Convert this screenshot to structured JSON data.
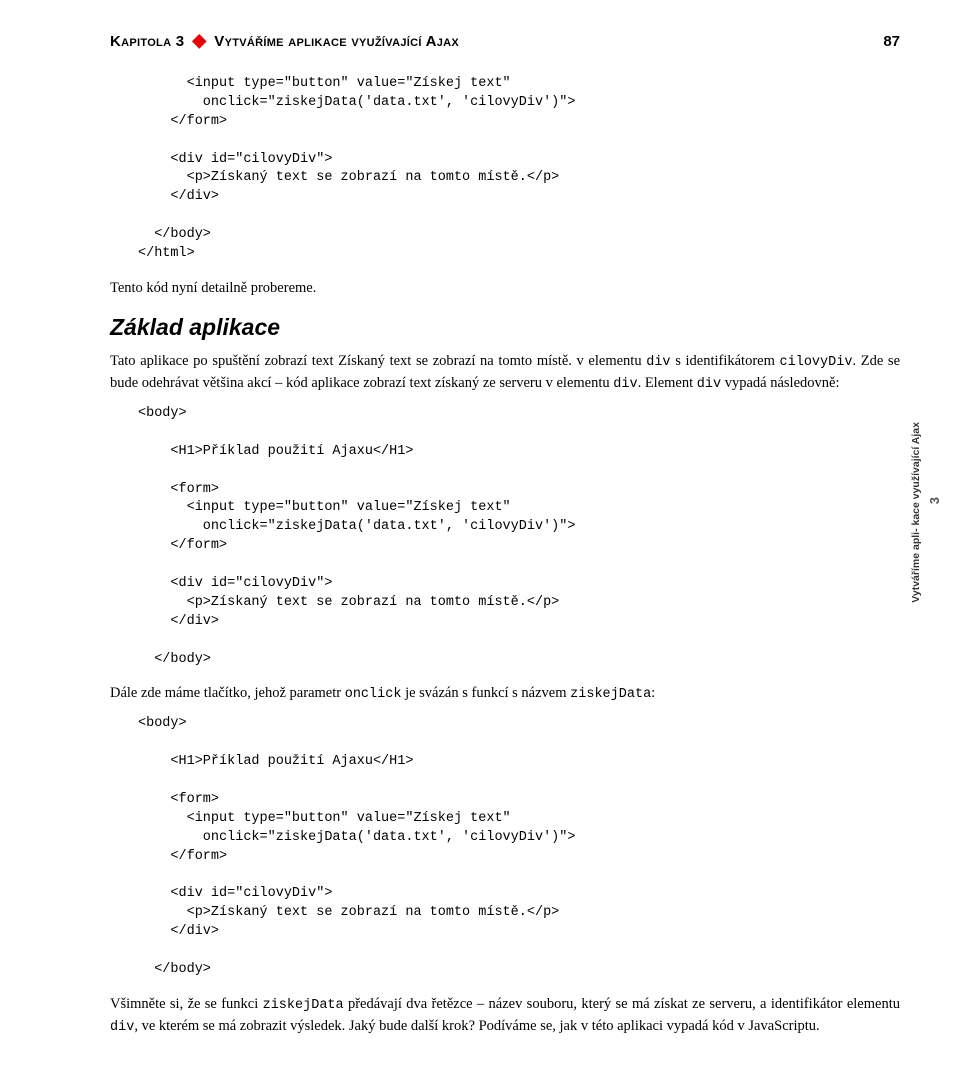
{
  "header": {
    "chapter": "Kapitola 3",
    "title": "Vytváříme aplikace využívající Ajax",
    "pageNum": "87"
  },
  "code1": "      <input type=\"button\" value=\"Získej text\"\n        onclick=\"ziskejData('data.txt', 'cilovyDiv')\">\n    </form>\n\n    <div id=\"cilovyDiv\">\n      <p>Získaný text se zobrazí na tomto místě.</p>\n    </div>\n\n  </body>\n</html>",
  "para1": "Tento kód nyní detailně probereme.",
  "section1": "Základ aplikace",
  "para2a": "Tato aplikace po spuštění zobrazí text Získaný text se zobrazí na tomto místě. v elementu ",
  "para2b": " s identifikátorem ",
  "para2c": ". Zde se bude odehrávat většina akcí – kód aplikace zobrazí text získaný ze serveru v elementu ",
  "para2d": ". Element ",
  "para2e": " vypadá následovně:",
  "mono_div": "div",
  "mono_cilovy": "cilovyDiv",
  "code2": "<body>\n\n    <H1>Příklad použití Ajaxu</H1>\n\n    <form>\n      <input type=\"button\" value=\"Získej text\"\n        onclick=\"ziskejData('data.txt', 'cilovyDiv')\">\n    </form>\n\n    <div id=\"cilovyDiv\">\n      <p>Získaný text se zobrazí na tomto místě.</p>\n    </div>\n\n  </body>",
  "para3a": "Dále zde máme tlačítko, jehož parametr ",
  "para3b": " je svázán s funkcí s názvem ",
  "para3c": ":",
  "mono_onclick": "onclick",
  "mono_ziskej": "ziskejData",
  "code3": "<body>\n\n    <H1>Příklad použití Ajaxu</H1>\n\n    <form>\n      <input type=\"button\" value=\"Získej text\"\n        onclick=\"ziskejData('data.txt', 'cilovyDiv')\">\n    </form>\n\n    <div id=\"cilovyDiv\">\n      <p>Získaný text se zobrazí na tomto místě.</p>\n    </div>\n\n  </body>",
  "para4a": "Všimněte si, že se funkci ",
  "para4b": " předávají dva řetězce – název souboru, který se má získat ze serveru, a identifikátor elementu ",
  "para4c": ", ve kterém se má zobrazit výsledek. Jaký bude další krok? Podíváme se, jak v této aplikaci vypadá kód v JavaScriptu.",
  "sideTab": {
    "num": "3",
    "text": "Vytváříme apli-\nkace využívající\nAjax"
  }
}
